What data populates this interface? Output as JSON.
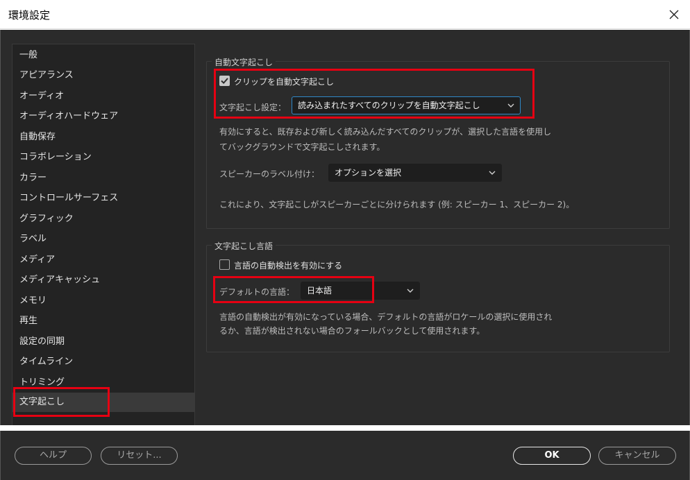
{
  "window": {
    "title": "環境設定"
  },
  "sidebar": {
    "items": [
      {
        "label": "一般"
      },
      {
        "label": "アピアランス"
      },
      {
        "label": "オーディオ"
      },
      {
        "label": "オーディオハードウェア"
      },
      {
        "label": "自動保存"
      },
      {
        "label": "コラボレーション"
      },
      {
        "label": "カラー"
      },
      {
        "label": "コントロールサーフェス"
      },
      {
        "label": "グラフィック"
      },
      {
        "label": "ラベル"
      },
      {
        "label": "メディア"
      },
      {
        "label": "メディアキャッシュ"
      },
      {
        "label": "メモリ"
      },
      {
        "label": "再生"
      },
      {
        "label": "設定の同期"
      },
      {
        "label": "タイムライン"
      },
      {
        "label": "トリミング"
      },
      {
        "label": "文字起こし"
      }
    ],
    "selected": "文字起こし"
  },
  "auto_transcribe": {
    "group_title": "自動文字起こし",
    "checkbox_label": "クリップを自動文字起こし",
    "checkbox_checked": true,
    "setting_label": "文字起こし設定：",
    "setting_value": "読み込まれたすべてのクリップを自動文字起こし",
    "description_line1": "有効にすると、既存および新しく読み込んだすべてのクリップが、選択した言語を使用し",
    "description_line2": "てバックグラウンドで文字起こしされます。",
    "speaker_label": "スピーカーのラベル付け：",
    "speaker_value": "オプションを選択",
    "speaker_description": "これにより、文字起こしがスピーカーごとに分けられます (例: スピーカー 1、スピーカー 2)。"
  },
  "language": {
    "group_title": "文字起こし言語",
    "auto_detect_label": "言語の自動検出を有効にする",
    "auto_detect_checked": false,
    "default_label": "デフォルトの言語：",
    "default_value": "日本語",
    "description_line1": "言語の自動検出が有効になっている場合、デフォルトの言語がロケールの選択に使用され",
    "description_line2": "るか、言語が検出されない場合のフォールバックとして使用されます。"
  },
  "footer": {
    "help_label": "ヘルプ",
    "reset_label": "リセット...",
    "ok_label": "OK",
    "cancel_label": "キャンセル"
  },
  "colors": {
    "panel_bg": "#2b2b2b",
    "highlight_red": "#e60012",
    "focus_blue": "#2f88c9"
  }
}
